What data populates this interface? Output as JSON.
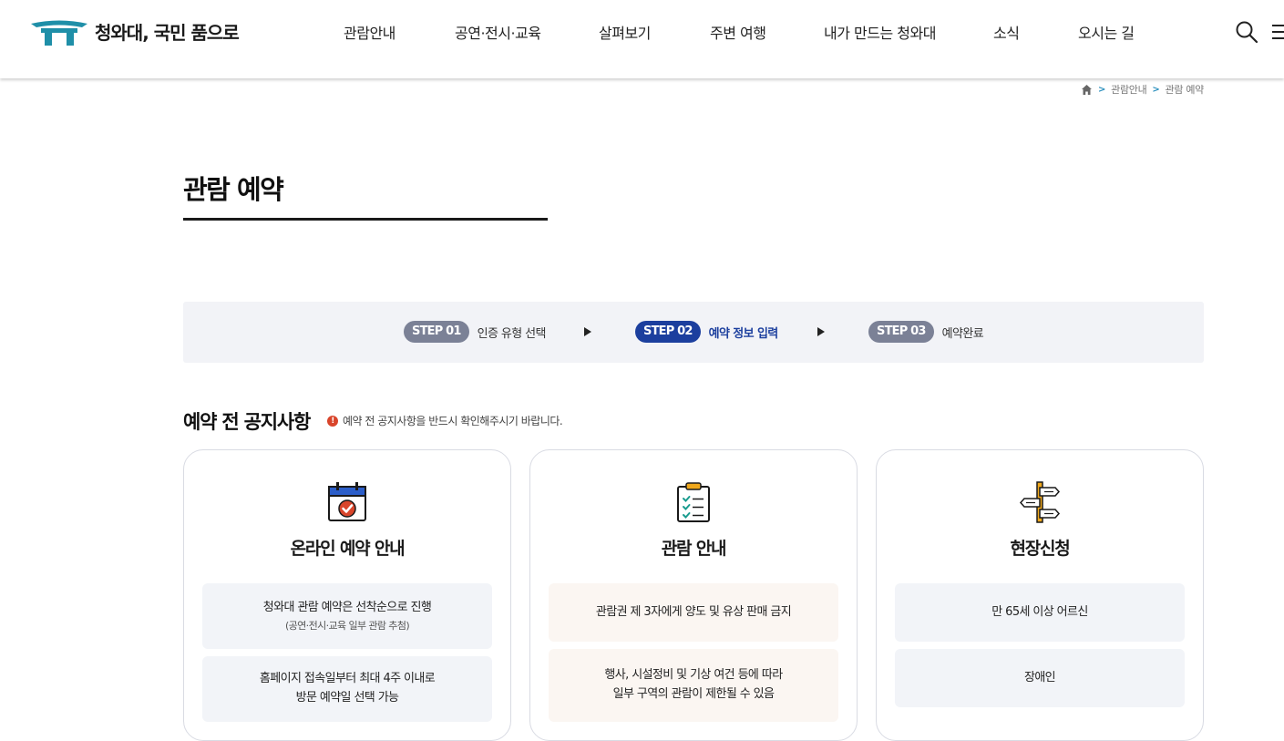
{
  "header": {
    "logo_text": "청와대, 국민 품으로",
    "nav": [
      "관람안내",
      "공연·전시·교육",
      "살펴보기",
      "주변 여행",
      "내가 만드는 청와대",
      "소식",
      "오시는 길"
    ],
    "search_icon": "search-icon",
    "menu_icon": "menu-icon"
  },
  "breadcrumb": {
    "home_icon": "home-icon",
    "items": [
      "관람안내",
      "관람 예약"
    ]
  },
  "page": {
    "title": "관람 예약"
  },
  "steps": [
    {
      "badge": "STEP 01",
      "label": "인증 유형 선택",
      "active": false
    },
    {
      "badge": "STEP 02",
      "label": "예약 정보 입력",
      "active": true
    },
    {
      "badge": "STEP 03",
      "label": "예약완료",
      "active": false
    }
  ],
  "notice": {
    "title": "예약 전 공지사항",
    "info_icon_glyph": "!",
    "subtitle": "예약 전 공지사항을 반드시 확인해주시기 바랍니다."
  },
  "cards": [
    {
      "icon": "calendar-check-icon",
      "title": "온라인 예약 안내",
      "items": [
        {
          "line1": "청와대 관람 예약은 선착순으로 진행",
          "line2": "(공연·전시·교육 일부 관람 추첨)"
        },
        {
          "line1": "홈페이지 접속일부터 최대 4주 이내로",
          "line2": "방문 예약일 선택 가능"
        }
      ]
    },
    {
      "icon": "clipboard-checklist-icon",
      "title": "관람 안내",
      "items": [
        {
          "line1": "관람권 제 3자에게 양도 및 유상 판매 금지",
          "line2": ""
        },
        {
          "line1": "행사, 시설정비 및 기상 여건 등에 따라",
          "line2": "일부 구역의 관람이 제한될 수 있음"
        }
      ]
    },
    {
      "icon": "signpost-icon",
      "title": "현장신청",
      "items": [
        {
          "line1": "만 65세 이상 어르신",
          "line2": ""
        },
        {
          "line1": "장애인",
          "line2": ""
        }
      ]
    }
  ],
  "colors": {
    "brand_teal": "#1f8fa8",
    "step_active": "#1c3f9e",
    "step_inactive": "#7b8196",
    "info_red": "#d9452b"
  }
}
